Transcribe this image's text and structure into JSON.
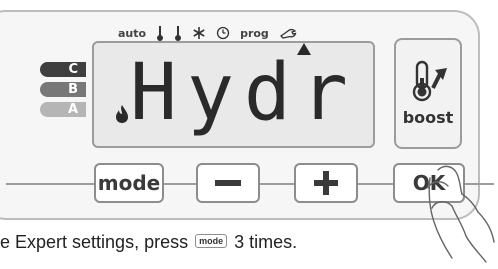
{
  "indicators": {
    "auto_label": "auto",
    "prog_label": "prog",
    "icons": [
      "thermometer-icon",
      "thermometer-icon",
      "snowflake-icon",
      "clock-icon",
      "wrench-icon"
    ]
  },
  "lcd": {
    "display_text": "Hydr",
    "flame_icon": "flame-icon",
    "pointer_icon": "triangle-up-icon"
  },
  "tabs": [
    {
      "label": "C"
    },
    {
      "label": "B"
    },
    {
      "label": "A"
    }
  ],
  "boost": {
    "label": "boost",
    "icon": "thermometer-up-arrow-icon"
  },
  "keys": {
    "mode_label": "mode",
    "minus_label": "−",
    "plus_label": "+",
    "ok_label": "OK"
  },
  "instruction": {
    "prefix": "e Expert settings, press",
    "key_label": "mode",
    "suffix": "3 times."
  }
}
